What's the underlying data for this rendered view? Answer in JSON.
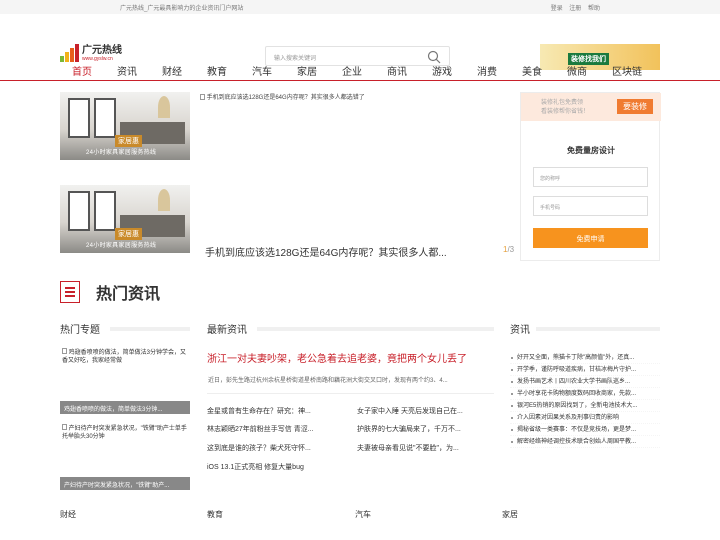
{
  "topbar": {
    "slogan": "广元热线_广元最具影响力的企业资讯门户网站",
    "login": "登录",
    "register": "注册",
    "help": "帮助"
  },
  "logo": {
    "name": "广元热线",
    "url": "www.gyslw.cn",
    "colors": [
      "#7bb838",
      "#f2b21a",
      "#e85d1b",
      "#c8202a"
    ]
  },
  "search": {
    "placeholder": "输入搜索关键词",
    "icon": "search-icon"
  },
  "ad_top": {
    "text": "装修找我们"
  },
  "nav": {
    "items": [
      "首页",
      "资讯",
      "财经",
      "教育",
      "汽车",
      "家居",
      "企业",
      "商讯",
      "游戏",
      "消费",
      "美食",
      "微商",
      "区块链"
    ],
    "active_color": "#c8202a"
  },
  "slides": [
    {
      "brand": "家居惠",
      "caption": "24小时家具家居服务热线"
    },
    {
      "brand": "家居惠",
      "caption": "24小时家具家居服务热线"
    }
  ],
  "feature": {
    "image_alt": "手机到底应该选128G还是64G内存呢？其实很多人都选错了",
    "caption": "手机到底应该选128G还是64G内存呢？其实很多人都...",
    "page_current": "1",
    "page_total": "/3"
  },
  "form": {
    "banner_text_1": "装修礼包免费领",
    "banner_text_2": "看装修帮你省钱！",
    "banner_button": "要装修",
    "title": "免费量房设计",
    "name_placeholder": "您的称呼",
    "phone_placeholder": "手机号码",
    "submit": "免费申请",
    "accent": "#f7931e"
  },
  "hot": {
    "title": "热门资讯"
  },
  "columns": {
    "topics": "热门专题",
    "latest": "最新资讯",
    "news": "资讯"
  },
  "topics": [
    {
      "img": "鸡翅香喷喷的做法，简单做法3分钟学会，又香又好吃，我家经常做",
      "bar": "鸡翅香喷喷的做法，简单做法3分钟..."
    },
    {
      "img": "产妇待产时突发紧急状况，\"铁臂\"助产士单手托举胎头30分钟",
      "bar": "产妇待产时突发紧急状况，\"铁臂\"助产..."
    }
  ],
  "latest": {
    "headline": "浙江一对夫妻吵架，老公急着去追老婆，竟把两个女儿丢了",
    "summary": "近日，彭先生路过杭州余杭星桥街道星桥南路和藕花洲大街交叉口时，发现有两个约3、4...",
    "links": [
      "金星或曾有生命存在？研究：神...",
      "女子家中入睡 天亮后发现自己在...",
      "林志颖晒27年前粉丝手写信 青涩...",
      "护肤界的七大骗局来了，千万不...",
      "这到底是谁的孩子？柴犬死守怀...",
      "夫妻被母亲看见说\"不要脸\"，为...",
      "iOS 13.1正式亮相 修复大量bug"
    ]
  },
  "news": [
    "好开又全面，熊猫卡丁除\"高颜值\"外，还真...",
    "开学季，谨防呼吸道疾病，甘桔冰梅片守护...",
    "发扬书画艺术丨四川农业大学书画队巡乡...",
    "半小时享花卡购物额度数码回收商家，先款...",
    "银河E5热销的原因找到了，全新电池技术大...",
    "介入因素对因果关系及刑事归责的影响",
    "揭秘省级一类赛事：不仅是竞技场，更是梦...",
    "解密经络神经调控技术联合创始人周国平教..."
  ],
  "categories": [
    "财经",
    "教育",
    "汽车",
    "家居"
  ]
}
